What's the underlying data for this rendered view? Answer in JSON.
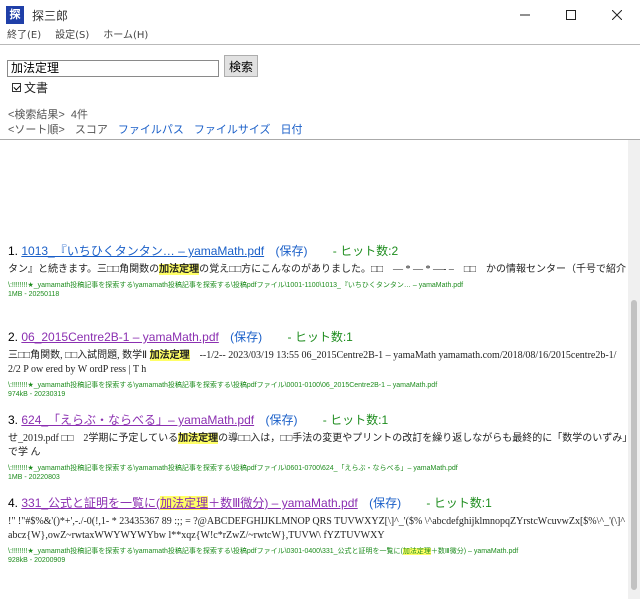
{
  "window": {
    "icon_label": "探",
    "title": "探三郎",
    "minimize": "─",
    "maximize": "☐",
    "close": "✕"
  },
  "menu": [
    "終了(E)",
    "設定(S)",
    "ホーム(H)"
  ],
  "search": {
    "value": "加法定理",
    "button_label": "検索",
    "doc_checkbox_label": "文書",
    "doc_checked": true
  },
  "summary": {
    "label": "<検索結果>",
    "count": "4件"
  },
  "sort": {
    "label": "<ソート順>",
    "options": [
      "スコア",
      "ファイルパス",
      "ファイルサイズ",
      "日付"
    ]
  },
  "results": [
    {
      "num": "1.",
      "title": "1013_『いちひくタンタン… – yamaMath.pdf",
      "save": "(保存)",
      "hits": "- ヒット数:2",
      "snippet_pre": "タン』と続きます。三□□角関数の",
      "snippet_hl": "加法定理",
      "snippet_post": "の覚え□□方にこんなのがありました。□□　— * — * —‐ –　□□　かの情報センター（千号で紹介",
      "path": "\\:!!!!!!!!★_yamamath投稿記事を探索する\\yamamath投稿記事を探索する\\投稿pdfファイル\\1001-1100\\1013_『いちひくタンタン… – yamaMath.pdf",
      "meta": "1MB - 20250118"
    },
    {
      "num": "2.",
      "title": "06_2015Centre2B-1 – yamaMath.pdf",
      "save": "(保存)",
      "hits": "- ヒット数:1",
      "snippet_pre": "三□□角関数, □□入試問題, 数学Ⅱ ",
      "snippet_hl": "加法定理",
      "snippet_post": "　--1/2-- 2023/03/19 13:55 06_2015Centre2B-1 – yamaMath yamamath.com/2018/08/16/2015centre2b-1/ 2/2 P ow ered by W ordP ress | T h",
      "path": "\\:!!!!!!!!★_yamamath投稿記事を探索する\\yamamath投稿記事を探索する\\投稿pdfファイル\\0001-0100\\06_2015Centre2B-1 – yamaMath.pdf",
      "meta": "974kB - 20230319"
    },
    {
      "num": "3.",
      "title": "624_「えらぶ・ならべる」– yamaMath.pdf",
      "save": "(保存)",
      "hits": "- ヒット数:1",
      "snippet_pre": "せ_2019.pdf □□　2学期に予定している",
      "snippet_hl": "加法定理",
      "snippet_post": "の導□□入は，□□手法の変更やプリントの改訂を繰り返しながらも最終的に「数学のいずみ」で学 ん",
      "path": "\\:!!!!!!!!★_yamamath投稿記事を探索する\\yamamath投稿記事を探索する\\投稿pdfファイル\\0601-0700\\624_「えらぶ・ならべる」– yamaMath.pdf",
      "meta": "1MB - 20220803"
    },
    {
      "num": "4.",
      "title_pre": "331_公式と証明を一覧に(",
      "title_hl": "加法定理",
      "title_post": "＋数Ⅲ微分) – yamaMath.pdf",
      "save": "(保存)",
      "hits": "- ヒット数:1",
      "snippet": "!\" !\"#$%&'()*+',-./-0(!,1- * 23435367 89 :;; = ?@ABCDEFGHIJKLMNOP QRS TUVWXYZ[\\]^_'($% \\^abcdefghijklmnopqZYrstcWcuvwZx[$%\\^_'(\\]^ abcz{W},owZ~rwtaxWWYWYWYbw l**xqz{W!c*rZwZ/~rwtcW},TUVW\\ fYZTUVWXY",
      "path_pre": "\\:!!!!!!!!★_yamamath投稿記事を探索する\\yamamath投稿記事を探索する\\投稿pdfファイル\\0301-0400\\331_公式と証明を一覧に(",
      "path_hl": "加法定理",
      "path_post": "＋数Ⅲ微分) – yamaMath.pdf",
      "meta": "928kB - 20200909"
    }
  ]
}
